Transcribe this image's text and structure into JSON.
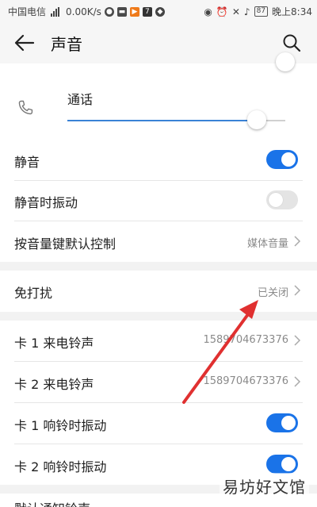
{
  "status_bar": {
    "carrier": "中国电信",
    "net_speed": "0.00K/s",
    "battery": "87",
    "time": "晚上8:34"
  },
  "header": {
    "title": "声音"
  },
  "call_volume": {
    "label": "通话",
    "level_fraction": 0.87
  },
  "rows": [
    {
      "label": "静音",
      "toggle": "on"
    },
    {
      "label": "静音时振动",
      "toggle": "off"
    },
    {
      "label": "按音量键默认控制",
      "value": "媒体音量"
    },
    {
      "label": "免打扰",
      "value": "已关闭"
    },
    {
      "label": "卡 1 来电铃声",
      "value": "15897046733​76"
    },
    {
      "label": "卡 2 来电铃声",
      "value": "1589704673376"
    },
    {
      "label": "卡 1 响铃时振动",
      "toggle": "on"
    },
    {
      "label": "卡 2 响铃时振动",
      "toggle": "on"
    },
    {
      "label": "默认通知铃声"
    }
  ],
  "annotation_color": "#e03030",
  "watermark": "易坊好文馆"
}
